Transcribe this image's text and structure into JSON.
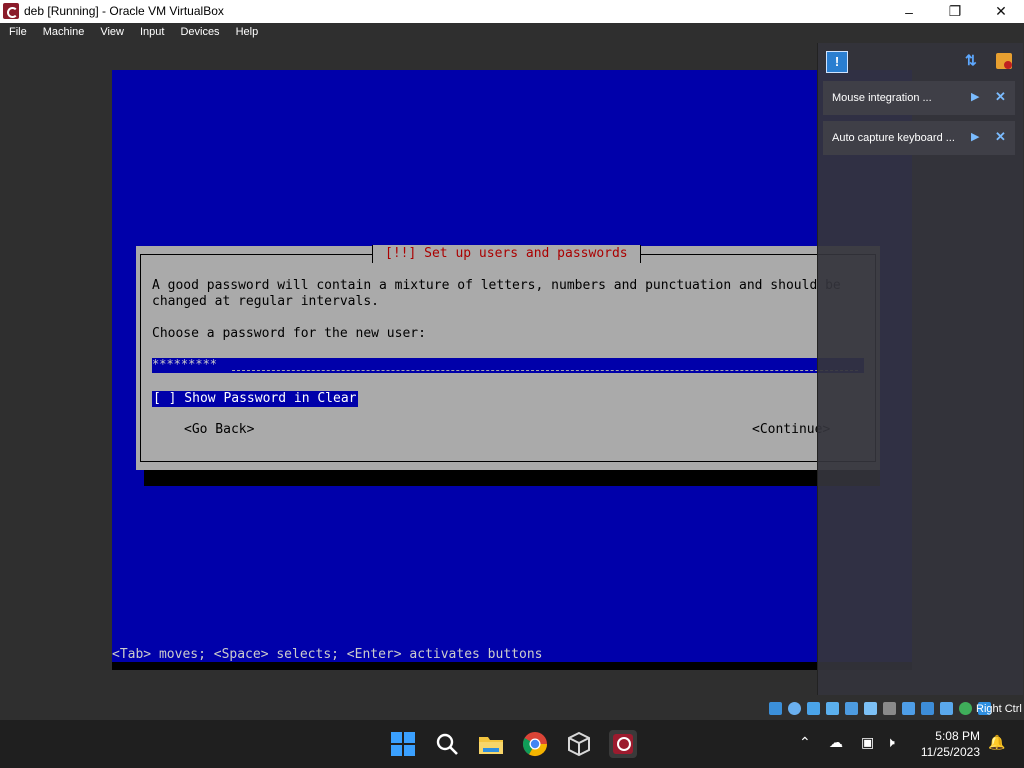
{
  "window": {
    "title": "deb [Running] - Oracle VM VirtualBox"
  },
  "menu": [
    "File",
    "Machine",
    "View",
    "Input",
    "Devices",
    "Help"
  ],
  "dialog": {
    "title": "[!!] Set up users and passwords",
    "line1": "A good password will contain a mixture of letters, numbers and punctuation and should be",
    "line2": "changed at regular intervals.",
    "prompt": "Choose a password for the new user:",
    "password_value": "*********",
    "checkbox_label": "[ ] Show Password in Clear",
    "back_label": "<Go Back>",
    "continue_label": "<Continue>"
  },
  "hint": "<Tab> moves; <Space> selects; <Enter> activates buttons",
  "notifications": {
    "items": [
      {
        "label": "Mouse integration ..."
      },
      {
        "label": "Auto capture keyboard ..."
      }
    ]
  },
  "statusbar": {
    "host_key": "Right Ctrl"
  },
  "clock": {
    "time": "5:08 PM",
    "date": "11/25/2023"
  },
  "colors": {
    "guest_blue": "#0000aa",
    "dialog_gray": "#aaaaaa",
    "title_red": "#aa0000"
  }
}
